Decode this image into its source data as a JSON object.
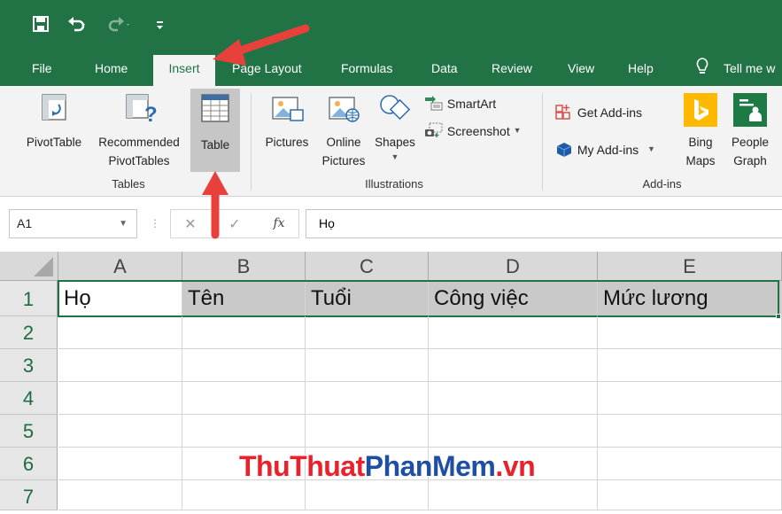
{
  "quick_access": {
    "save": "save-icon",
    "undo": "undo-icon",
    "redo": "redo-icon",
    "customize": "customize-qat-icon"
  },
  "tabs": [
    {
      "label": "File"
    },
    {
      "label": "Home"
    },
    {
      "label": "Insert",
      "active": true
    },
    {
      "label": "Page Layout"
    },
    {
      "label": "Formulas"
    },
    {
      "label": "Data"
    },
    {
      "label": "Review"
    },
    {
      "label": "View"
    },
    {
      "label": "Help"
    },
    {
      "label": "Tell me w"
    }
  ],
  "ribbon": {
    "tables": {
      "pivottable": "PivotTable",
      "recommended_line1": "Recommended",
      "recommended_line2": "PivotTables",
      "table": "Table",
      "group": "Tables"
    },
    "illustrations": {
      "pictures": "Pictures",
      "online_line1": "Online",
      "online_line2": "Pictures",
      "shapes": "Shapes",
      "smartart": "SmartArt",
      "screenshot": "Screenshot",
      "group": "Illustrations"
    },
    "addins": {
      "get": "Get Add-ins",
      "my": "My Add-ins",
      "bing_line1": "Bing",
      "bing_line2": "Maps",
      "people_line1": "People",
      "people_line2": "Graph",
      "group": "Add-ins"
    }
  },
  "formula_bar": {
    "name_box": "A1",
    "formula": "Họ",
    "fx": "fx"
  },
  "sheet": {
    "columns": [
      "A",
      "B",
      "C",
      "D",
      "E"
    ],
    "rows": [
      "1",
      "2",
      "3",
      "4",
      "5",
      "6",
      "7"
    ],
    "row1": [
      "Họ",
      "Tên",
      "Tuổi",
      "Công việc",
      "Mức lương"
    ]
  },
  "watermark": {
    "part1": "ThuThuat",
    "part2": "PhanMem",
    "part3": ".vn"
  },
  "colors": {
    "excel_green": "#217346",
    "arrow_red": "#e8413b",
    "selection": "#c9c9c9"
  }
}
